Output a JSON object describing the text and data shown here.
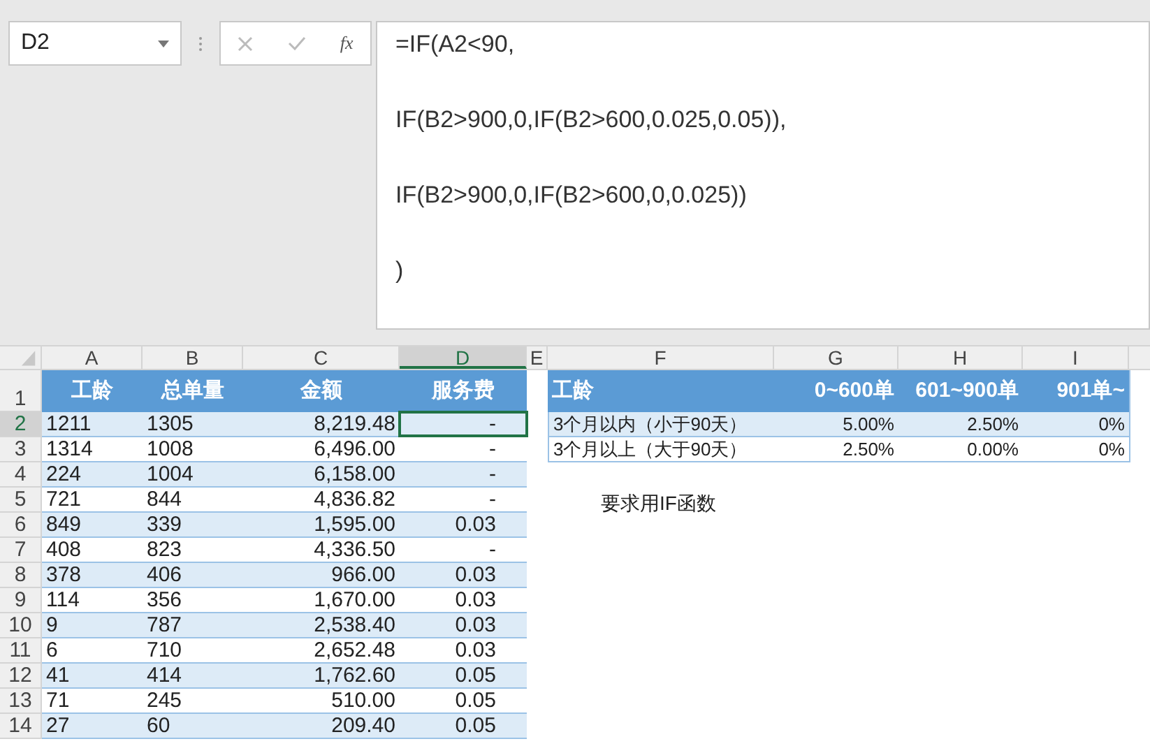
{
  "name_box": {
    "value": "D2"
  },
  "formula_bar": {
    "function_label": "fx",
    "lines": [
      "=IF(A2<90,",
      "IF(B2>900,0,IF(B2>600,0.025,0.05)),",
      "IF(B2>900,0,IF(B2>600,0,0.025))",
      ")"
    ]
  },
  "column_headers": [
    {
      "label": "A",
      "selected": false
    },
    {
      "label": "B",
      "selected": false
    },
    {
      "label": "C",
      "selected": false
    },
    {
      "label": "D",
      "selected": true
    },
    {
      "label": "E",
      "selected": false
    },
    {
      "label": "F",
      "selected": false
    },
    {
      "label": "G",
      "selected": false
    },
    {
      "label": "H",
      "selected": false
    },
    {
      "label": "I",
      "selected": false
    }
  ],
  "row_headers": [
    {
      "label": "1",
      "selected": false
    },
    {
      "label": "2",
      "selected": true
    },
    {
      "label": "3",
      "selected": false
    },
    {
      "label": "4",
      "selected": false
    },
    {
      "label": "5",
      "selected": false
    },
    {
      "label": "6",
      "selected": false
    },
    {
      "label": "7",
      "selected": false
    },
    {
      "label": "8",
      "selected": false
    },
    {
      "label": "9",
      "selected": false
    },
    {
      "label": "10",
      "selected": false
    },
    {
      "label": "11",
      "selected": false
    },
    {
      "label": "12",
      "selected": false
    },
    {
      "label": "13",
      "selected": false
    },
    {
      "label": "14",
      "selected": false
    }
  ],
  "main_table": {
    "columns": [
      "工龄",
      "总单量",
      "金额",
      "服务费"
    ],
    "rows": [
      {
        "cells": [
          {
            "text": "1211",
            "selected": false
          },
          {
            "text": "1305",
            "selected": false
          },
          {
            "text": "8,219.48",
            "selected": false
          },
          {
            "text": "-",
            "selected": true
          }
        ]
      },
      {
        "cells": [
          {
            "text": "1314",
            "selected": false
          },
          {
            "text": "1008",
            "selected": false
          },
          {
            "text": "6,496.00",
            "selected": false
          },
          {
            "text": "-",
            "selected": false
          }
        ]
      },
      {
        "cells": [
          {
            "text": "224",
            "selected": false
          },
          {
            "text": "1004",
            "selected": false
          },
          {
            "text": "6,158.00",
            "selected": false
          },
          {
            "text": "-",
            "selected": false
          }
        ]
      },
      {
        "cells": [
          {
            "text": "721",
            "selected": false
          },
          {
            "text": "844",
            "selected": false
          },
          {
            "text": "4,836.82",
            "selected": false
          },
          {
            "text": "-",
            "selected": false
          }
        ]
      },
      {
        "cells": [
          {
            "text": "849",
            "selected": false
          },
          {
            "text": "339",
            "selected": false
          },
          {
            "text": "1,595.00",
            "selected": false
          },
          {
            "text": "0.03",
            "selected": false
          }
        ]
      },
      {
        "cells": [
          {
            "text": "408",
            "selected": false
          },
          {
            "text": "823",
            "selected": false
          },
          {
            "text": "4,336.50",
            "selected": false
          },
          {
            "text": "-",
            "selected": false
          }
        ]
      },
      {
        "cells": [
          {
            "text": "378",
            "selected": false
          },
          {
            "text": "406",
            "selected": false
          },
          {
            "text": "966.00",
            "selected": false
          },
          {
            "text": "0.03",
            "selected": false
          }
        ]
      },
      {
        "cells": [
          {
            "text": "114",
            "selected": false
          },
          {
            "text": "356",
            "selected": false
          },
          {
            "text": "1,670.00",
            "selected": false
          },
          {
            "text": "0.03",
            "selected": false
          }
        ]
      },
      {
        "cells": [
          {
            "text": "9",
            "selected": false
          },
          {
            "text": "787",
            "selected": false
          },
          {
            "text": "2,538.40",
            "selected": false
          },
          {
            "text": "0.03",
            "selected": false
          }
        ]
      },
      {
        "cells": [
          {
            "text": "6",
            "selected": false
          },
          {
            "text": "710",
            "selected": false
          },
          {
            "text": "2,652.48",
            "selected": false
          },
          {
            "text": "0.03",
            "selected": false
          }
        ]
      },
      {
        "cells": [
          {
            "text": "41",
            "selected": false
          },
          {
            "text": "414",
            "selected": false
          },
          {
            "text": "1,762.60",
            "selected": false
          },
          {
            "text": "0.05",
            "selected": false
          }
        ]
      },
      {
        "cells": [
          {
            "text": "71",
            "selected": false
          },
          {
            "text": "245",
            "selected": false
          },
          {
            "text": "510.00",
            "selected": false
          },
          {
            "text": "0.05",
            "selected": false
          }
        ]
      },
      {
        "cells": [
          {
            "text": "27",
            "selected": false
          },
          {
            "text": "60",
            "selected": false
          },
          {
            "text": "209.40",
            "selected": false
          },
          {
            "text": "0.05",
            "selected": false
          }
        ]
      }
    ]
  },
  "rate_table": {
    "columns": [
      "工龄",
      "0~600单",
      "601~900单",
      "901单~"
    ],
    "rows": [
      {
        "cells": [
          "3个月以内（小于90天）",
          "5.00%",
          "2.50%",
          "0%"
        ]
      },
      {
        "cells": [
          "3个月以上（大于90天）",
          "2.50%",
          "0.00%",
          "0%"
        ]
      }
    ]
  },
  "note": "要求用IF函数"
}
